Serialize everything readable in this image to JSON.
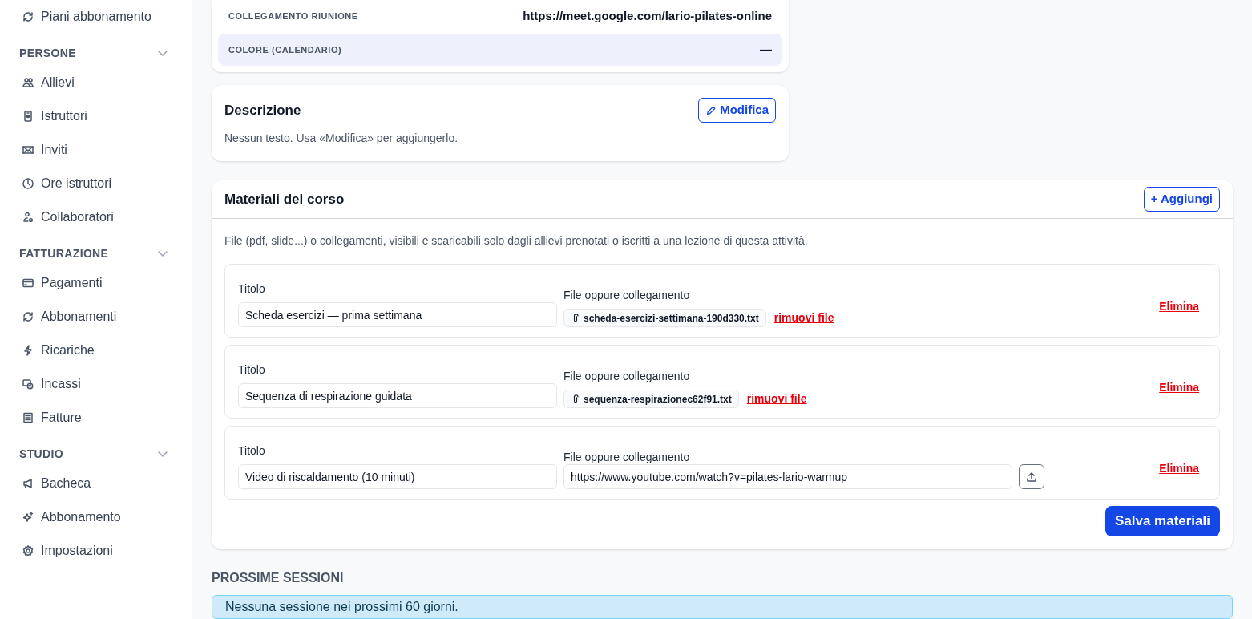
{
  "sidebar": {
    "top_items": [
      {
        "label": "Piani abbonamento"
      }
    ],
    "sections": [
      {
        "title": "PERSONE",
        "expanded": true,
        "items": [
          {
            "label": "Allievi"
          },
          {
            "label": "Istruttori"
          },
          {
            "label": "Inviti"
          },
          {
            "label": "Ore istruttori"
          },
          {
            "label": "Collaboratori"
          }
        ]
      },
      {
        "title": "FATTURAZIONE",
        "expanded": true,
        "items": [
          {
            "label": "Pagamenti"
          },
          {
            "label": "Abbonamenti"
          },
          {
            "label": "Ricariche"
          },
          {
            "label": "Incassi"
          },
          {
            "label": "Fatture"
          }
        ]
      },
      {
        "title": "STUDIO",
        "expanded": true,
        "items": [
          {
            "label": "Bacheca"
          },
          {
            "label": "Abbonamento"
          },
          {
            "label": "Impostazioni"
          }
        ]
      }
    ]
  },
  "details": {
    "rows": [
      {
        "label": "COLLEGAMENTO RIUNIONE",
        "value": "https://meet.google.com/lario-pilates-online",
        "highlighted": false
      },
      {
        "label": "COLORE (CALENDARIO)",
        "value": "—",
        "highlighted": true
      }
    ]
  },
  "description": {
    "title": "Descrizione",
    "edit_button": "Modifica",
    "text": "Nessun testo. Usa «Modifica» per aggiungerlo."
  },
  "materials": {
    "title": "Materiali del corso",
    "add_button": "+ Aggiungi",
    "note": "File (pdf, slide...) o collegamenti, visibili e scaricabili solo dagli allievi prenotati o iscritti a una lezione di questa attività.",
    "items": [
      {
        "kind": "file",
        "title_label": "Titolo",
        "title_value": "Scheda esercizi — prima settimana",
        "source_label": "File oppure collegamento",
        "file_name": "scheda-esercizi-settimana-190d330.txt",
        "remove_link": "rimuovi file",
        "delete_link": "Elimina"
      },
      {
        "kind": "file",
        "title_label": "Titolo",
        "title_value": "Sequenza di respirazione guidata",
        "source_label": "File oppure collegamento",
        "file_name": "sequenza-respirazionec62f91.txt",
        "remove_link": "rimuovi file",
        "delete_link": "Elimina"
      },
      {
        "kind": "link",
        "title_label": "Titolo",
        "title_value": "Video di riscaldamento (10 minuti)",
        "source_label": "File oppure collegamento",
        "link_value": "https://www.youtube.com/watch?v=pilates-lario-warmup",
        "delete_link": "Elimina"
      }
    ],
    "save_button": "Salva materiali"
  },
  "sessions": {
    "heading": "PROSSIME SESSIONI",
    "empty_message": "Nessuna sessione nei prossimi 60 giorni."
  }
}
